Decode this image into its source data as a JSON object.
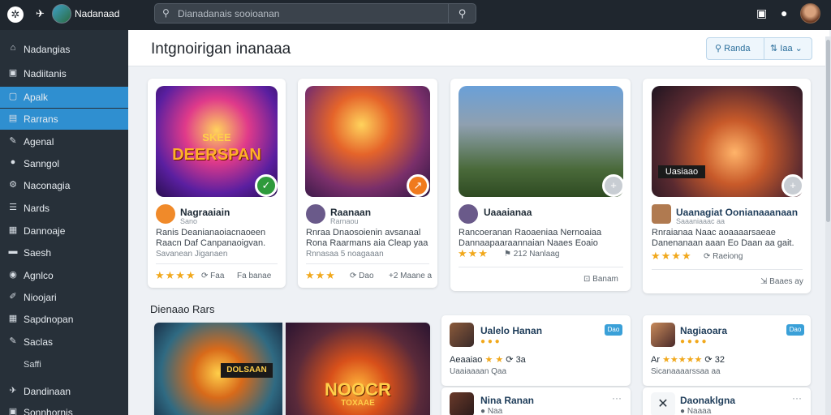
{
  "topbar": {
    "app_title": "Nadanaad",
    "search_placeholder": "Dianadanais sooioanan"
  },
  "sidebar": {
    "items": [
      {
        "label": "Nadangias",
        "icon": "home-icon",
        "glyph": "⌂"
      },
      {
        "label": "Nadiitanis",
        "icon": "inbox-icon",
        "glyph": "▣"
      },
      {
        "label": "Apalk",
        "icon": "apps-icon",
        "glyph": "▢",
        "active": true
      },
      {
        "label": "Rarrans",
        "icon": "bookmark-icon",
        "glyph": "▤",
        "active": true
      },
      {
        "label": "Agenal",
        "icon": "pen-icon",
        "glyph": "✎"
      },
      {
        "label": "Sanngol",
        "icon": "circle-icon",
        "glyph": "●"
      },
      {
        "label": "Naconagia",
        "icon": "settings-icon",
        "glyph": "⚙"
      },
      {
        "label": "Nards",
        "icon": "list-icon",
        "glyph": "☰"
      },
      {
        "label": "Dannoaje",
        "icon": "doc-icon",
        "glyph": "▦"
      },
      {
        "label": "Saesh",
        "icon": "folder-icon",
        "glyph": "▬"
      },
      {
        "label": "Agnlco",
        "icon": "globe-icon",
        "glyph": "◉"
      },
      {
        "label": "Nioojari",
        "icon": "edit-icon",
        "glyph": "✐"
      },
      {
        "label": "Sapdnopan",
        "icon": "grid-icon",
        "glyph": "▦"
      },
      {
        "label": "Saclas",
        "icon": "tag-icon",
        "glyph": "✎"
      },
      {
        "label": "Saffi",
        "icon": "",
        "glyph": "",
        "sub": true
      },
      {
        "label": "Dandinaan",
        "icon": "pin-icon",
        "glyph": "✈"
      },
      {
        "label": "Sonnhornis",
        "icon": "doc-icon",
        "glyph": "▣"
      }
    ]
  },
  "header": {
    "title": "Intgnoirigan inanaaa",
    "btn_primary": "Randa",
    "btn_secondary": "Iaa"
  },
  "featured": [
    {
      "art_text": "DEERSPAN",
      "art_text2": "SKEE",
      "name": "Nagraaiain",
      "sub": "Sano",
      "desc_line1": "Ranis Deanianaoiacnaoeen",
      "desc_line2": "Raacn Daf Canpanaoigvan.",
      "note": "Savanean Jiganaen",
      "rating": 4,
      "meta": "Faa",
      "foot": "Fa banae"
    },
    {
      "art_text": "",
      "art_text2": "",
      "name": "Raanaan",
      "sub": "Rarnaou",
      "desc_line1": "Rnraa Dnaosoienin avsanaal",
      "desc_line2": "Rona Raarmans aia Cleap yaa",
      "note": "Rnnasaa 5 noagaaan",
      "rating": 3,
      "meta": "Dao",
      "foot": "+2 Maane a"
    },
    {
      "art_text": "",
      "art_text2": "",
      "name": "Uaaaianaa",
      "sub": "",
      "desc_line1": "Rancoeranan Raoaeniaa Nernoaiaa",
      "desc_line2": "Dannaapaaraannaian Naaes Eoaio",
      "note": "",
      "rating": 3,
      "meta": "212 Nanlaag",
      "foot": "Banam"
    },
    {
      "art_text": "Uasiaao",
      "art_text2": "",
      "name": "Uaanagiat Oonianaaanaan",
      "sub": "Saaaniaaac aa",
      "desc_line1": "Rnraianaa Naac aoaaaarsaeae",
      "desc_line2": "Danenanaan aaan Eo Daan aa gait.",
      "note": "",
      "rating": 4,
      "meta": "Raeiong",
      "foot": "Baaes ay"
    }
  ],
  "section": {
    "title": "Dienaao Rars"
  },
  "banners": [
    {
      "art_text": "DOLSAAN",
      "art_text2": ""
    },
    {
      "art_text": "NOOCR",
      "art_text2": "TOXAAE"
    }
  ],
  "list_col1": [
    {
      "name": "Ualelo Hanan",
      "badge": "Dao",
      "sub_rating": "Aeaaiao",
      "rating_suffix": "3a",
      "sub": "Uaaiaaaan Qaa"
    },
    {
      "name": "Nina Ranan",
      "badge": "",
      "sub_rating": "Naa",
      "rating_suffix": "",
      "sub": ""
    }
  ],
  "list_col2": [
    {
      "name": "Nagiaoara",
      "badge": "Dao",
      "sub_rating": "Ar",
      "rating_suffix": "32",
      "sub": "Sicanaaaarssaa aa"
    },
    {
      "name": "Daonaklgna",
      "badge": "",
      "sub_rating": "Naaaa",
      "rating_suffix": "",
      "sub": ""
    }
  ],
  "colors": {
    "topbar": "#1f262e",
    "sidebar": "#273039",
    "accent": "#2f8fd0",
    "star": "#f1a81c"
  }
}
